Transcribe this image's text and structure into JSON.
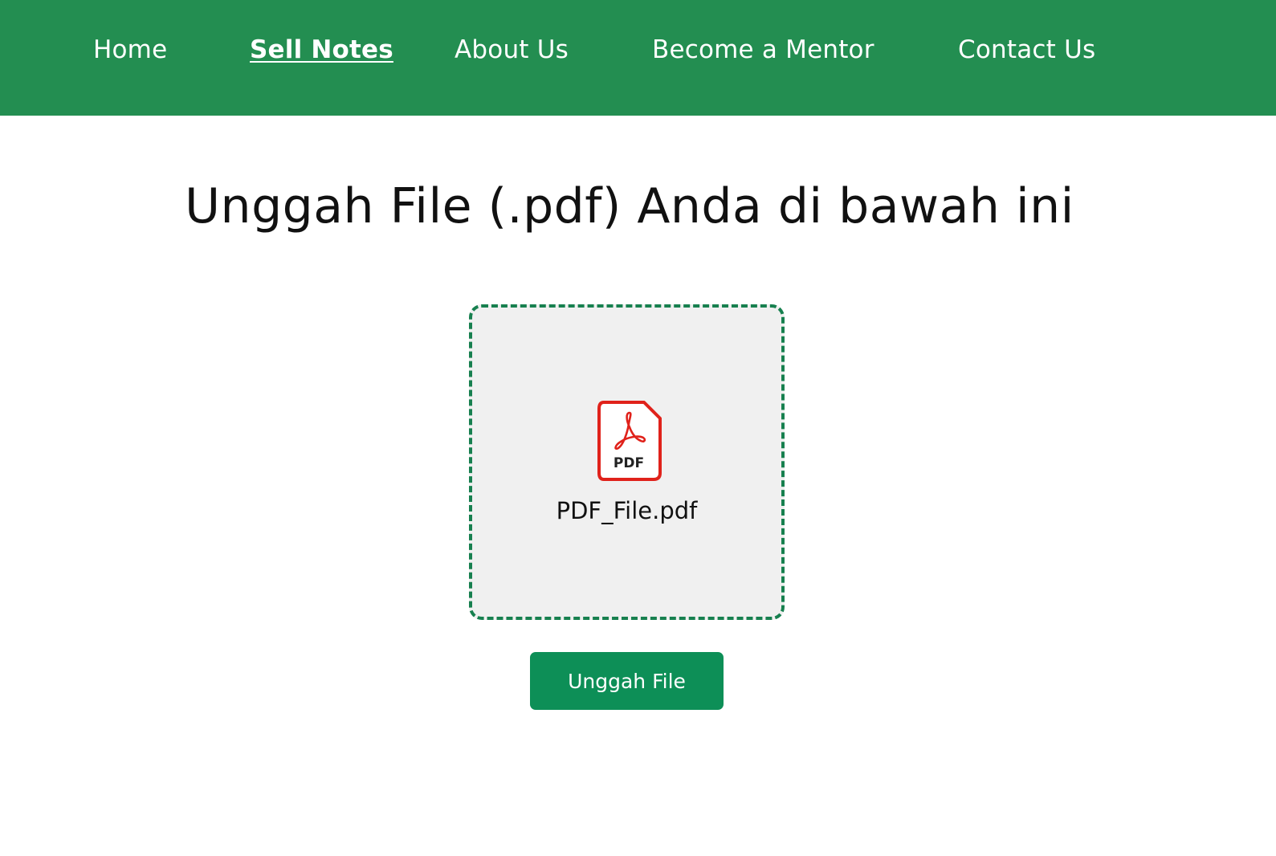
{
  "nav": {
    "items": [
      {
        "label": "Home",
        "active": false
      },
      {
        "label": "Sell Notes",
        "active": true
      },
      {
        "label": "About Us",
        "active": false
      },
      {
        "label": "Become a Mentor",
        "active": false
      },
      {
        "label": "Contact Us",
        "active": false
      }
    ]
  },
  "main": {
    "title": "Unggah File (.pdf) Anda di bawah ini",
    "dropzone": {
      "file_icon": "pdf-file-icon",
      "file_icon_label": "PDF",
      "file_name": "PDF_File.pdf"
    },
    "upload_button_label": "Unggah File"
  },
  "colors": {
    "navbar_background": "#238e51",
    "dropzone_border": "#17804f",
    "dropzone_background": "#f0f0f0",
    "button_background": "#0d8f57",
    "pdf_icon_red": "#e0221b"
  }
}
